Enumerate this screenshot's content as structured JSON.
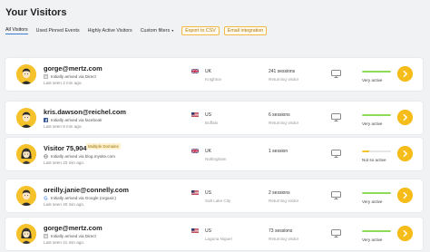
{
  "page": {
    "title": "Your Visitors"
  },
  "filters": {
    "tabs": [
      {
        "label": "All Visitors",
        "active": true
      },
      {
        "label": "Used Pinned Events",
        "active": false
      },
      {
        "label": "Highly Active Visitors",
        "active": false
      },
      {
        "label": "Custom filters",
        "active": false
      }
    ],
    "export_label": "Export to CSV",
    "email_label": "Email integration"
  },
  "visitors": [
    {
      "name": "gorge@mertz.com",
      "badge": "",
      "source": "Initially arrived via Direct",
      "source_icon": "direct-icon",
      "last_seen": "Last seen 2 min ago.",
      "country": "UK",
      "flag": "uk-flag-icon",
      "city": "Knighton",
      "sessions": "241 sessions",
      "visitor_type": "Returning visitor",
      "activity": "Very active",
      "activity_level": 1.0,
      "activity_color": "#8ed85a"
    },
    {
      "name": "kris.dawson@reichel.com",
      "badge": "",
      "source": "Initially arrived via facebook",
      "source_icon": "facebook-icon",
      "last_seen": "Last seen 8 min ago.",
      "country": "US",
      "flag": "us-flag-icon",
      "city": "Buffalo",
      "sessions": "6 sessions",
      "visitor_type": "Returning visitor",
      "activity": "Very active",
      "activity_level": 1.0,
      "activity_color": "#8ed85a"
    },
    {
      "name": "Visitor 75,904",
      "badge": "Multiple Domains",
      "source": "Initially arrived via blog.mysite.com",
      "source_icon": "link-icon",
      "last_seen": "Last seen 23 min ago.",
      "country": "UK",
      "flag": "uk-flag-icon",
      "city": "Nottingham",
      "sessions": "1 session",
      "visitor_type": "",
      "activity": "Not so active",
      "activity_level": 0.25,
      "activity_color": "#f6c22c"
    },
    {
      "name": "oreilly.janie@connelly.com",
      "badge": "",
      "source": "Initially arrived via Google (organic)",
      "source_icon": "google-icon",
      "last_seen": "Last seen 40 min ago.",
      "country": "US",
      "flag": "us-flag-icon",
      "city": "Salt Lake City",
      "sessions": "2 sessions",
      "visitor_type": "Returning visitor",
      "activity": "Very active",
      "activity_level": 1.0,
      "activity_color": "#8ed85a"
    },
    {
      "name": "gorge@mertz.com",
      "badge": "",
      "source": "Initially arrived via Direct",
      "source_icon": "direct-icon",
      "last_seen": "Last seen 41 min ago.",
      "country": "US",
      "flag": "us-flag-icon",
      "city": "Laguna Niguel",
      "sessions": "73 sessions",
      "visitor_type": "Returning visitor",
      "activity": "Very active",
      "activity_level": 1.0,
      "activity_color": "#8ed85a"
    }
  ]
}
